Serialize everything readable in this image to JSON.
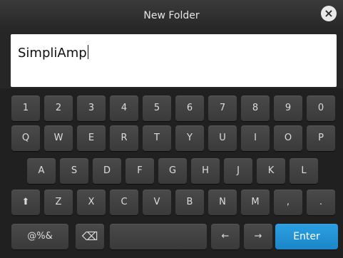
{
  "window": {
    "title": "New Folder"
  },
  "input": {
    "value": "SimpliAmp"
  },
  "keyboard": {
    "row1": [
      "1",
      "2",
      "3",
      "4",
      "5",
      "6",
      "7",
      "8",
      "9",
      "0"
    ],
    "row2": [
      "Q",
      "W",
      "E",
      "R",
      "T",
      "Y",
      "U",
      "I",
      "O",
      "P"
    ],
    "row3": [
      "A",
      "S",
      "D",
      "F",
      "G",
      "H",
      "J",
      "K",
      "L"
    ],
    "row4": [
      "Z",
      "X",
      "C",
      "V",
      "B",
      "N",
      "M",
      ",",
      "."
    ],
    "symbols_label": "@%&",
    "enter_label": "Enter"
  },
  "colors": {
    "accent": "#1e90d6"
  },
  "icons": {
    "close": "close-icon",
    "shift": "shift-icon",
    "backspace": "backspace-icon",
    "left": "arrow-left-icon",
    "right": "arrow-right-icon"
  }
}
